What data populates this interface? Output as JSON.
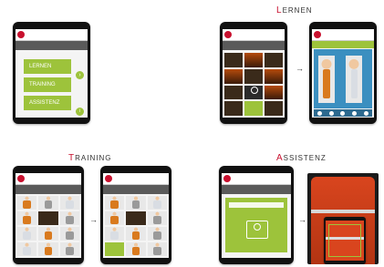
{
  "sections": {
    "lernen": {
      "first": "L",
      "rest": "ERNEN"
    },
    "training": {
      "first": "T",
      "rest": "RAINING"
    },
    "assistenz": {
      "first": "A",
      "rest": "SSISTENZ"
    }
  },
  "home": {
    "buttons": [
      {
        "first": "L",
        "rest": "ERNEN"
      },
      {
        "first": "T",
        "rest": "RAINING"
      },
      {
        "first": "A",
        "rest": "SSISTENZ"
      }
    ]
  },
  "colors": {
    "accent_red": "#c8102e",
    "accent_green": "#9dc33b",
    "bar_gray": "#5a5a5a",
    "tablet_frame": "#111111"
  },
  "icons": [
    "arrow-right-icon",
    "book-person-icon",
    "camera-person-icon",
    "info-icon"
  ]
}
